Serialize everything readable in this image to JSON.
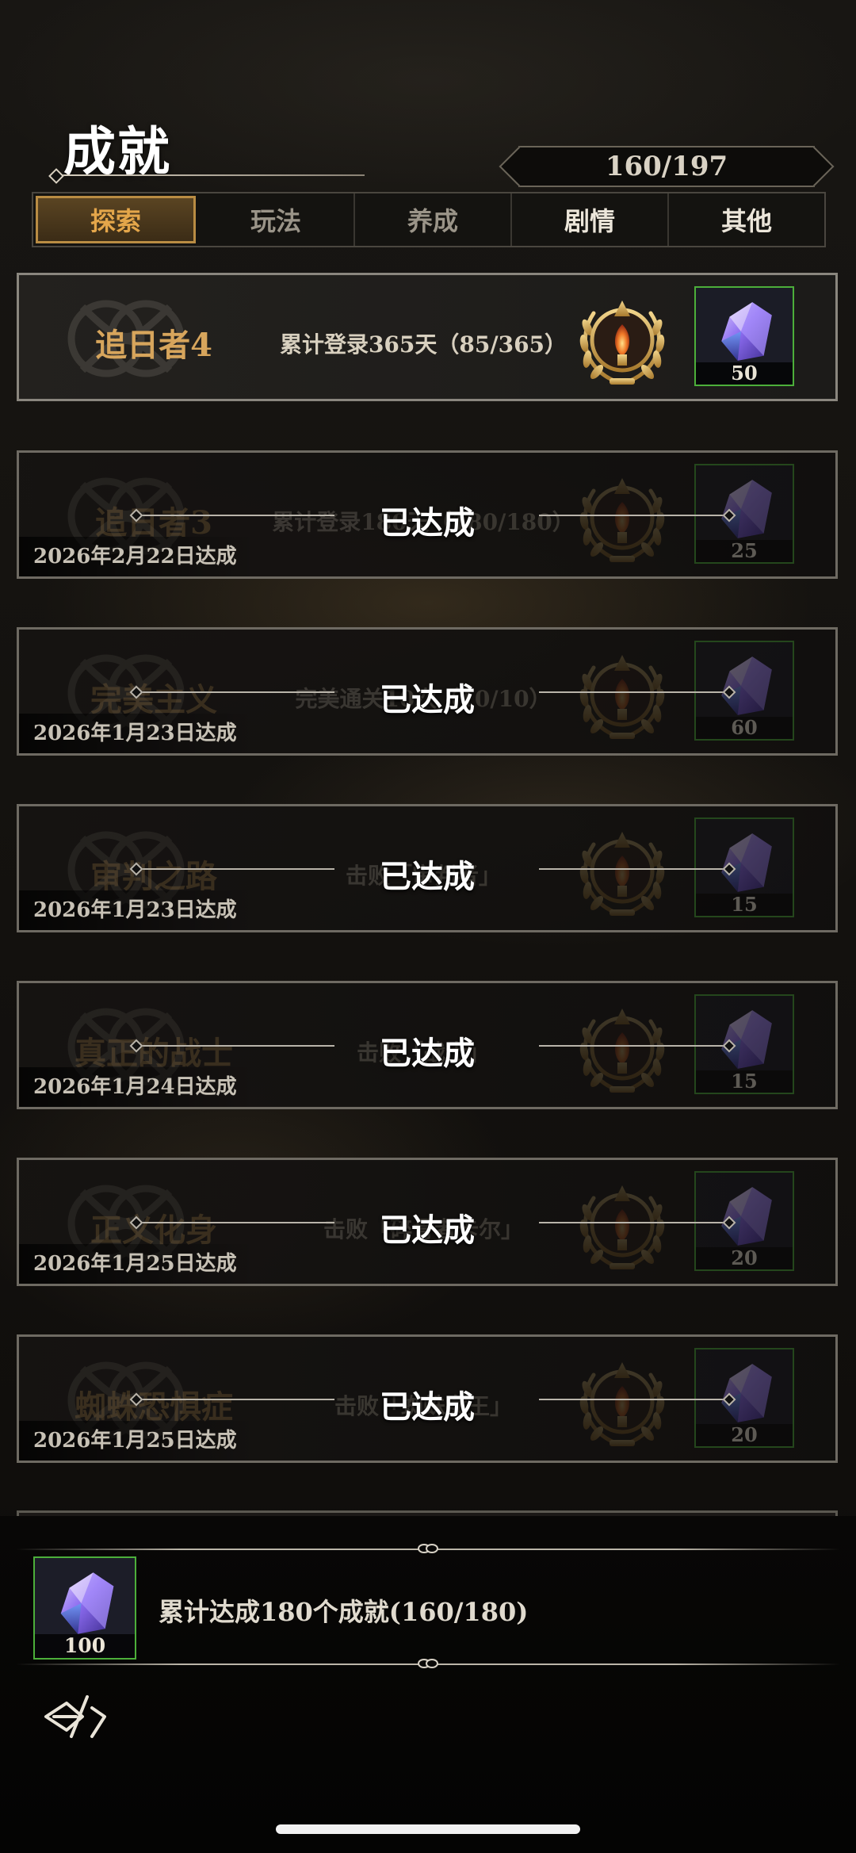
{
  "header": {
    "title": "成就",
    "progress": "160/197"
  },
  "tabs": [
    {
      "label": "探索",
      "active": true
    },
    {
      "label": "玩法",
      "active": false
    },
    {
      "label": "养成",
      "active": false
    },
    {
      "label": "剧情",
      "active": false
    },
    {
      "label": "其他",
      "active": false
    }
  ],
  "current_achievement": {
    "name": "追日者4",
    "description": "累计登录365天（85/365）",
    "medal_level": "4",
    "reward_count": "50"
  },
  "completed_achievements": [
    {
      "name": "追日者3",
      "description": "累计登录180天（180/180）",
      "medal_level": "3",
      "status": "已达成",
      "date": "2026年2月22日达成",
      "reward_count": "25"
    },
    {
      "name": "完美主义",
      "description": "完美通关10次（10/10）",
      "medal_level": "",
      "status": "已达成",
      "date": "2026年1月23日达成",
      "reward_count": "60"
    },
    {
      "name": "审判之路",
      "description": "击败「审判者」",
      "medal_level": "",
      "status": "已达成",
      "date": "2026年1月23日达成",
      "reward_count": "15"
    },
    {
      "name": "真正的战士",
      "description": "击败「战士」",
      "medal_level": "",
      "status": "已达成",
      "date": "2026年1月24日达成",
      "reward_count": "15"
    },
    {
      "name": "正义化身",
      "description": "击败「碎骨者卡尔」",
      "medal_level": "",
      "status": "已达成",
      "date": "2026年1月25日达成",
      "reward_count": "20"
    },
    {
      "name": "蜘蛛恐惧症",
      "description": "击败「蜘蛛女王」",
      "medal_level": "",
      "status": "已达成",
      "date": "2026年1月25日达成",
      "reward_count": "20"
    }
  ],
  "total_reward": {
    "count": "100",
    "description": "累计达成180个成就(160/180)"
  },
  "icons": {
    "reward": "purple-crystal-icon",
    "medal": "laurel-medal-icon",
    "back": "back-arrow-icon"
  },
  "colors": {
    "accent_gold": "#e4a64a",
    "name_gold": "#d7a55c",
    "reward_border": "#4caf3a",
    "gem_purple": "#6a5ad8"
  }
}
